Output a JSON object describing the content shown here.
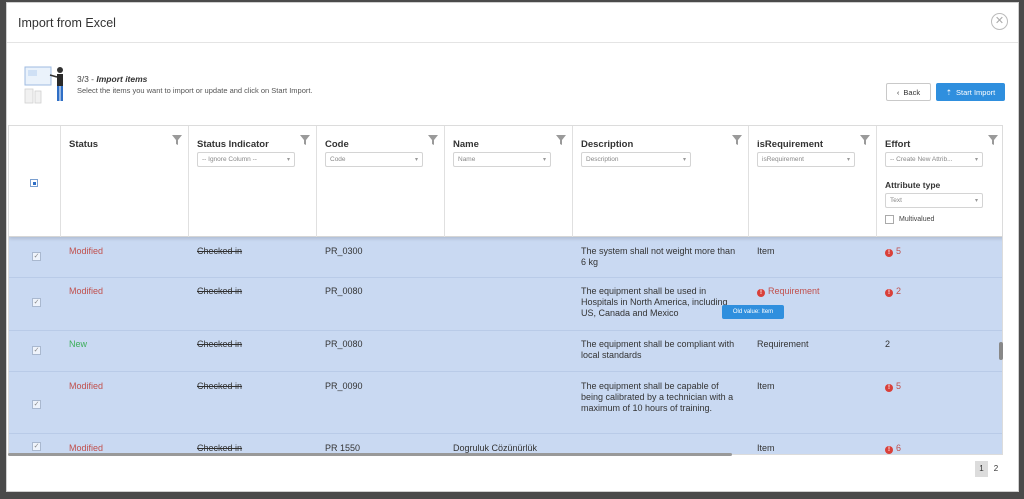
{
  "dialog": {
    "title": "Import from Excel",
    "close_icon": "close-circle-icon"
  },
  "intro": {
    "step_prefix": "3/3 -",
    "step_title": "Import items",
    "instruction": "Select the items you want to import or update and click on Start Import."
  },
  "buttons": {
    "back_label": "Back",
    "start_label": "Start Import",
    "accent": "#2f8fde"
  },
  "columns": [
    {
      "label": "Status"
    },
    {
      "label": "Status Indicator",
      "select": "-- Ignore Column --"
    },
    {
      "label": "Code",
      "select": "Code"
    },
    {
      "label": "Name",
      "select": "Name"
    },
    {
      "label": "Description",
      "select": "Description"
    },
    {
      "label": "isRequirement",
      "select": "isRequirement"
    },
    {
      "label": "Effort",
      "select": "-- Create New Attrib...",
      "attr_type_label": "Attribute type",
      "attr_type": "Text",
      "multivalued": "Multivalued"
    }
  ],
  "rows": [
    {
      "status": "Modified",
      "indicator": "Checked in",
      "code": "PR_0300",
      "name": "",
      "description": "The system shall not weight more than 6 kg",
      "is_req": "Item",
      "effort": "5"
    },
    {
      "status": "Modified",
      "indicator": "Checked in",
      "code": "PR_0080",
      "name": "",
      "description": "The equipment shall be used in Hospitals in North America, including US, Canada and Mexico",
      "is_req": "Requirement",
      "effort": "2"
    },
    {
      "status": "New",
      "indicator": "Checked in",
      "code": "PR_0080",
      "name": "",
      "description": "The equipment shall be compliant with local standards",
      "is_req": "Requirement",
      "effort": "2"
    },
    {
      "status": "Modified",
      "indicator": "Checked in",
      "code": "PR_0090",
      "name": "",
      "description": "The equipment shall be capable of being calibrated by a technician with a maximum of 10 hours of training.",
      "is_req": "Item",
      "effort": "5"
    },
    {
      "status": "Modified",
      "indicator": "Checked in",
      "code": "PR 1550",
      "name": "Dogruluk Cözünürlük",
      "description": "",
      "is_req": "Item",
      "effort": "6"
    }
  ],
  "tooltip": "Old value: Item",
  "pagination": {
    "page_1": "1",
    "page_2": "2"
  },
  "colors": {
    "selected_row": "#c9d9f2",
    "modified": "#c0504d",
    "new": "#3cae5a",
    "error": "#d9403a"
  }
}
